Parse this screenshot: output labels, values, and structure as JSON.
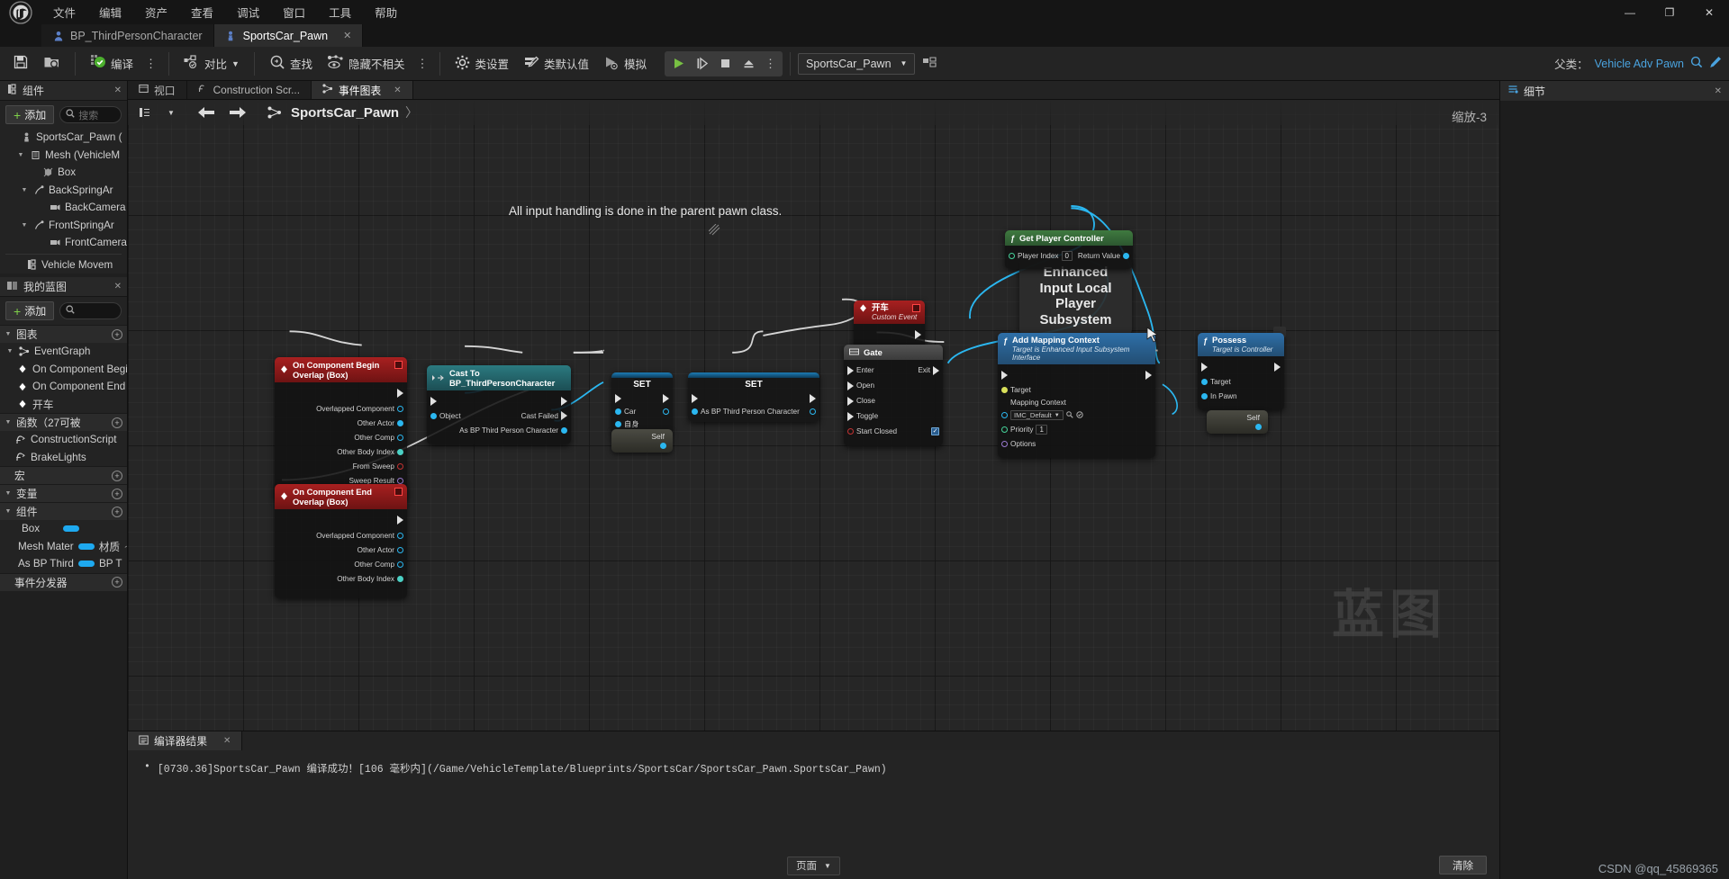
{
  "menu": {
    "items": [
      "文件",
      "编辑",
      "资产",
      "查看",
      "调试",
      "窗口",
      "工具",
      "帮助"
    ],
    "window_controls": {
      "minimize": "—",
      "maximize": "❐",
      "close": "✕"
    }
  },
  "tabs": [
    {
      "label": "BP_ThirdPersonCharacter",
      "icon": "character-icon",
      "active": false,
      "close": "✕"
    },
    {
      "label": "SportsCar_Pawn",
      "icon": "pawn-icon",
      "active": true,
      "close": "✕"
    }
  ],
  "toolbar": {
    "save_icon": "save-icon",
    "browse_icon": "browse-to-asset-icon",
    "compile_label": "编译",
    "diff_label": "对比",
    "find_label": "查找",
    "hide_unrelated_label": "隐藏不相关",
    "class_settings_label": "类设置",
    "class_defaults_label": "类默认值",
    "simulate_label": "模拟",
    "dots": "⋮",
    "play_icons": [
      "play-icon",
      "step-icon",
      "stop-icon",
      "eject-icon"
    ],
    "blueprint_combo": "SportsCar_Pawn",
    "debug_filter_icon": "debug-object-icon",
    "parent_label": "父类：",
    "parent_class": "Vehicle Adv Pawn",
    "search_icon": "search-icon",
    "edit_icon": "pencil-icon"
  },
  "components_panel": {
    "title": "组件",
    "close": "✕",
    "add_label": "添加",
    "search_placeholder": "搜索",
    "items": [
      {
        "label": "SportsCar_Pawn  (",
        "depth": 0,
        "arrow": "",
        "icon": "pawn-icon"
      },
      {
        "label": "Mesh (VehicleM",
        "depth": 1,
        "arrow": "▼",
        "icon": "skeletal-mesh-icon"
      },
      {
        "label": "Box",
        "depth": 2,
        "arrow": "",
        "icon": "collision-icon"
      },
      {
        "label": "BackSpringAr",
        "depth": 2,
        "arrow": "▼",
        "icon": "spring-arm-icon"
      },
      {
        "label": "BackCamera",
        "depth": 3,
        "arrow": "",
        "icon": "camera-icon"
      },
      {
        "label": "FrontSpringAr",
        "depth": 2,
        "arrow": "▼",
        "icon": "spring-arm-icon"
      },
      {
        "label": "FrontCamera",
        "depth": 3,
        "arrow": "",
        "icon": "camera-icon"
      },
      {
        "label": "Vehicle Movem",
        "depth": 1,
        "arrow": "",
        "icon": "component-icon"
      }
    ]
  },
  "myblueprint_panel": {
    "title": "我的蓝图",
    "close": "✕",
    "add_label": "添加",
    "search_placeholder": "",
    "sections": [
      {
        "title": "图表",
        "expand": "▼",
        "has_plus": true,
        "items": [
          {
            "label": "EventGraph",
            "depth": 0,
            "arrow": "▼",
            "icon": "graph-icon"
          },
          {
            "label": "On Component Begi",
            "depth": 1,
            "arrow": "",
            "icon": "event-icon"
          },
          {
            "label": "On Component End (",
            "depth": 1,
            "arrow": "",
            "icon": "event-icon"
          },
          {
            "label": "开车",
            "depth": 1,
            "arrow": "",
            "icon": "event-icon"
          }
        ]
      },
      {
        "title": "函数（27可被",
        "expand": "▼",
        "has_plus": true,
        "items": [
          {
            "label": "ConstructionScript",
            "depth": 0,
            "arrow": "",
            "icon": "function-icon"
          },
          {
            "label": "BrakeLights",
            "depth": 0,
            "arrow": "",
            "icon": "function-icon"
          }
        ]
      },
      {
        "title": "宏",
        "expand": "",
        "has_plus": true,
        "items": []
      },
      {
        "title": "变量",
        "expand": "▼",
        "has_plus": true,
        "items": []
      }
    ],
    "variables_group": {
      "title": "组件",
      "expand": "▼",
      "has_plus": true,
      "rows": [
        {
          "name": "Box",
          "type": "",
          "pill": true,
          "arrow": ""
        },
        {
          "name": "Mesh Mater",
          "type": "材质",
          "pill": true,
          "arrow": "〜"
        },
        {
          "name": "As BP Third",
          "type": "BP T",
          "pill": true,
          "arrow": "〜"
        }
      ]
    },
    "dispatchers_title": "事件分发器",
    "dispatchers_plus": true
  },
  "graph_tabs": [
    {
      "label": "视口",
      "icon": "viewport-icon",
      "active": false,
      "close": ""
    },
    {
      "label": "Construction Scr...",
      "icon": "construction-icon",
      "active": false,
      "close": ""
    },
    {
      "label": "事件图表",
      "icon": "eventgraph-icon",
      "active": true,
      "close": "✕"
    }
  ],
  "breadcrumb": {
    "back_icon": "arrow-left-icon",
    "forward_icon": "arrow-right-icon",
    "list_icon": "list-icon",
    "graph_icon": "graph-icon",
    "name": "SportsCar_Pawn",
    "separator": "〉",
    "zoom_label": "缩放-3"
  },
  "graph_comment": "All input handling is done in the parent pawn class.",
  "watermark": "蓝图",
  "nodes": {
    "on_begin_overlap": {
      "title": "On Component Begin Overlap (Box)",
      "outputs": [
        "Overlapped Component",
        "Other Actor",
        "Other Comp",
        "Other Body Index",
        "From Sweep",
        "Sweep Result"
      ]
    },
    "on_end_overlap": {
      "title": "On Component End Overlap (Box)",
      "outputs": [
        "Overlapped Component",
        "Other Actor",
        "Other Comp",
        "Other Body Index"
      ]
    },
    "cast_node": {
      "title": "Cast To BP_ThirdPersonCharacter",
      "in_object": "Object",
      "out_failed": "Cast Failed",
      "out_obj": "As BP Third Person Character"
    },
    "set_node_1": {
      "title": "SET",
      "pin_label": "Car"
    },
    "set_node_2": {
      "title": "SET",
      "pin_label": "As BP Third Person Character"
    },
    "set_self_1": {
      "label": "Self"
    },
    "set_self_2": {
      "label": "自身"
    },
    "custom_event": {
      "title": "开车",
      "subtitle": "Custom Event"
    },
    "gate": {
      "title": "Gate",
      "inputs": [
        "Enter",
        "Open",
        "Close",
        "Toggle",
        "Start Closed"
      ],
      "outputs": [
        "Exit"
      ],
      "start_closed_checked": "✓"
    },
    "get_player_controller": {
      "title": "Get Player Controller",
      "input_label": "Player Index",
      "input_value": "0",
      "output_label": "Return Value"
    },
    "subsystem": {
      "lines": [
        "Enhanced",
        "Input Local",
        "Player",
        "Subsystem"
      ]
    },
    "add_mapping_context": {
      "title": "Add Mapping Context",
      "subtitle": "Target is Enhanced Input Subsystem Interface",
      "inputs": [
        "Target",
        "Mapping Context",
        "Priority",
        "Options"
      ],
      "mapping_value": "IMC_Default",
      "priority_value": "1"
    },
    "possess": {
      "title": "Possess",
      "subtitle": "Target is Controller",
      "inputs": [
        "Target",
        "In Pawn"
      ]
    },
    "possess_self": {
      "label": "Self"
    }
  },
  "details_panel": {
    "title": "细节",
    "close": "✕",
    "icon": "details-icon"
  },
  "compiler_results": {
    "tab_label": "编译器结果",
    "tab_close": "✕",
    "bullet": "•",
    "message": "[0730.36]SportsCar_Pawn 编译成功！[106 毫秒内](/Game/VehicleTemplate/Blueprints/SportsCar/SportsCar_Pawn.SportsCar_Pawn)",
    "page_label": "页面",
    "clear_label": "清除"
  },
  "watermark_credit": "CSDN @qq_45869365",
  "colors": {
    "accent_blue": "#2bb7f0",
    "event_red": "#a82020",
    "cast_teal": "#2b7a80",
    "function_blue": "#2e6fa8",
    "pure_green": "#3f7a3f",
    "compile_green": "#7fd04a"
  }
}
